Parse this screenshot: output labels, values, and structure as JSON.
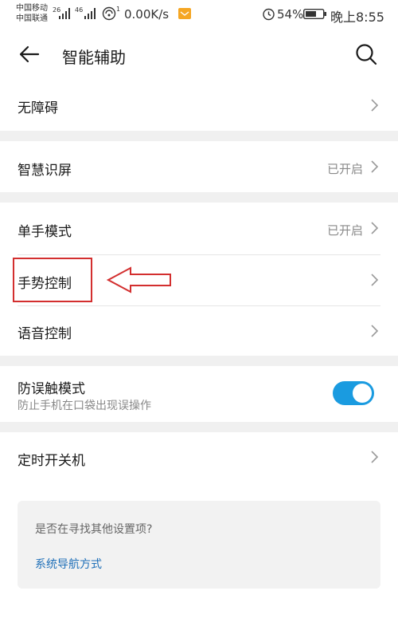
{
  "status_bar": {
    "carrier_1": "中国移动",
    "carrier_2": "中国联通",
    "signal_1_type": "26",
    "signal_2_type": "46",
    "wifi_sup": "1",
    "net_speed": "0.00K/s",
    "battery_pct": "54%",
    "time": "晚上8:55",
    "icons": [
      "signal-icon",
      "wifi-icon",
      "mail-icon",
      "alarm-icon",
      "battery-icon"
    ]
  },
  "header": {
    "title": "智能辅助",
    "back_icon": "back-arrow-icon",
    "search_icon": "search-icon"
  },
  "items": {
    "barrier_free": {
      "label": "无障碍"
    },
    "smart_screen": {
      "label": "智慧识屏",
      "value": "已开启"
    },
    "one_hand": {
      "label": "单手模式",
      "value": "已开启"
    },
    "gesture": {
      "label": "手势控制"
    },
    "voice": {
      "label": "语音控制"
    },
    "anti_touch": {
      "label": "防误触模式",
      "sub": "防止手机在口袋出现误操作",
      "enabled": true
    },
    "scheduled_power": {
      "label": "定时开关机"
    }
  },
  "suggestion": {
    "question": "是否在寻找其他设置项?",
    "link": "系统导航方式"
  },
  "colors": {
    "accent": "#1a9be0",
    "link": "#1e6fb8",
    "annotation": "#d32f2f",
    "gap": "#f0f0f0"
  }
}
